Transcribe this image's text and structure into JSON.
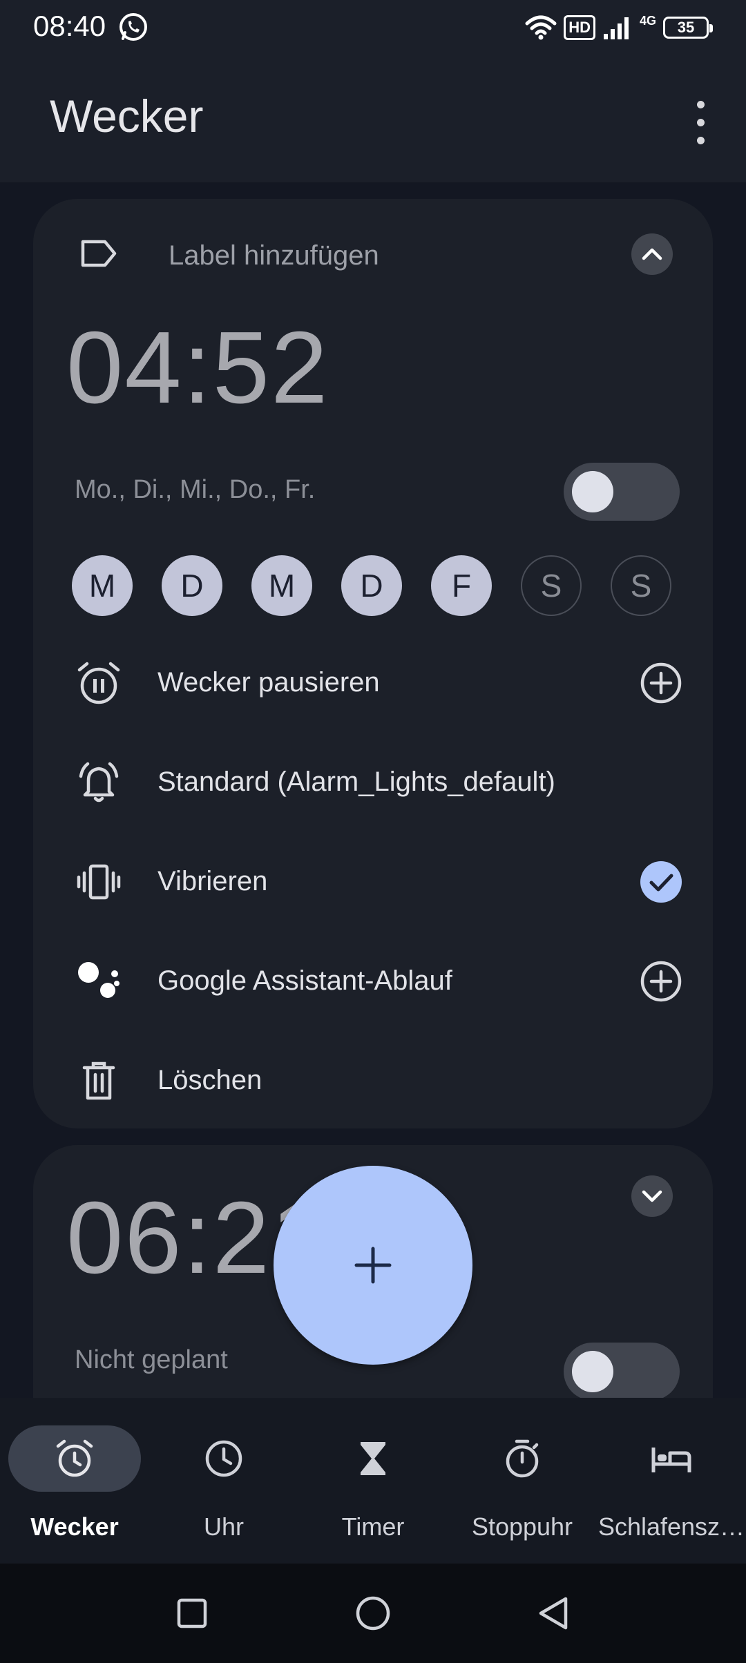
{
  "status_bar": {
    "time": "08:40",
    "hd": "HD",
    "network": "4G",
    "battery": "35",
    "icons": [
      "whatsapp-icon",
      "wifi-icon",
      "signal-icon",
      "battery-icon"
    ]
  },
  "app_bar": {
    "title": "Wecker",
    "overflow_icon": "more-vert-icon"
  },
  "alarms": [
    {
      "label_placeholder": "Label hinzufügen",
      "time": "04:52",
      "days_summary": "Mo., Di., Mi., Do., Fr.",
      "enabled": false,
      "expanded": true,
      "days": [
        {
          "letter": "M",
          "selected": true
        },
        {
          "letter": "D",
          "selected": true
        },
        {
          "letter": "M",
          "selected": true
        },
        {
          "letter": "D",
          "selected": true
        },
        {
          "letter": "F",
          "selected": true
        },
        {
          "letter": "S",
          "selected": false
        },
        {
          "letter": "S",
          "selected": false
        }
      ],
      "options": {
        "snooze": "Wecker pausieren",
        "ringtone": "Standard (Alarm_Lights_default)",
        "vibrate": "Vibrieren",
        "vibrate_checked": true,
        "assistant": "Google Assistant-Ablauf",
        "delete": "Löschen"
      }
    },
    {
      "time": "06:21",
      "subtitle": "Nicht geplant",
      "enabled": false,
      "expanded": false
    }
  ],
  "fab": {
    "icon": "plus-icon"
  },
  "bottom_nav": [
    {
      "label": "Wecker",
      "icon": "alarm-icon",
      "active": true
    },
    {
      "label": "Uhr",
      "icon": "clock-icon",
      "active": false
    },
    {
      "label": "Timer",
      "icon": "hourglass-icon",
      "active": false
    },
    {
      "label": "Stoppuhr",
      "icon": "stopwatch-icon",
      "active": false
    },
    {
      "label": "Schlafensz…",
      "icon": "bed-icon",
      "active": false
    }
  ],
  "colors": {
    "accent": "#aec6fb",
    "day_selected": "#c2c5d9",
    "card": "#1c2029",
    "background": "#131722"
  }
}
